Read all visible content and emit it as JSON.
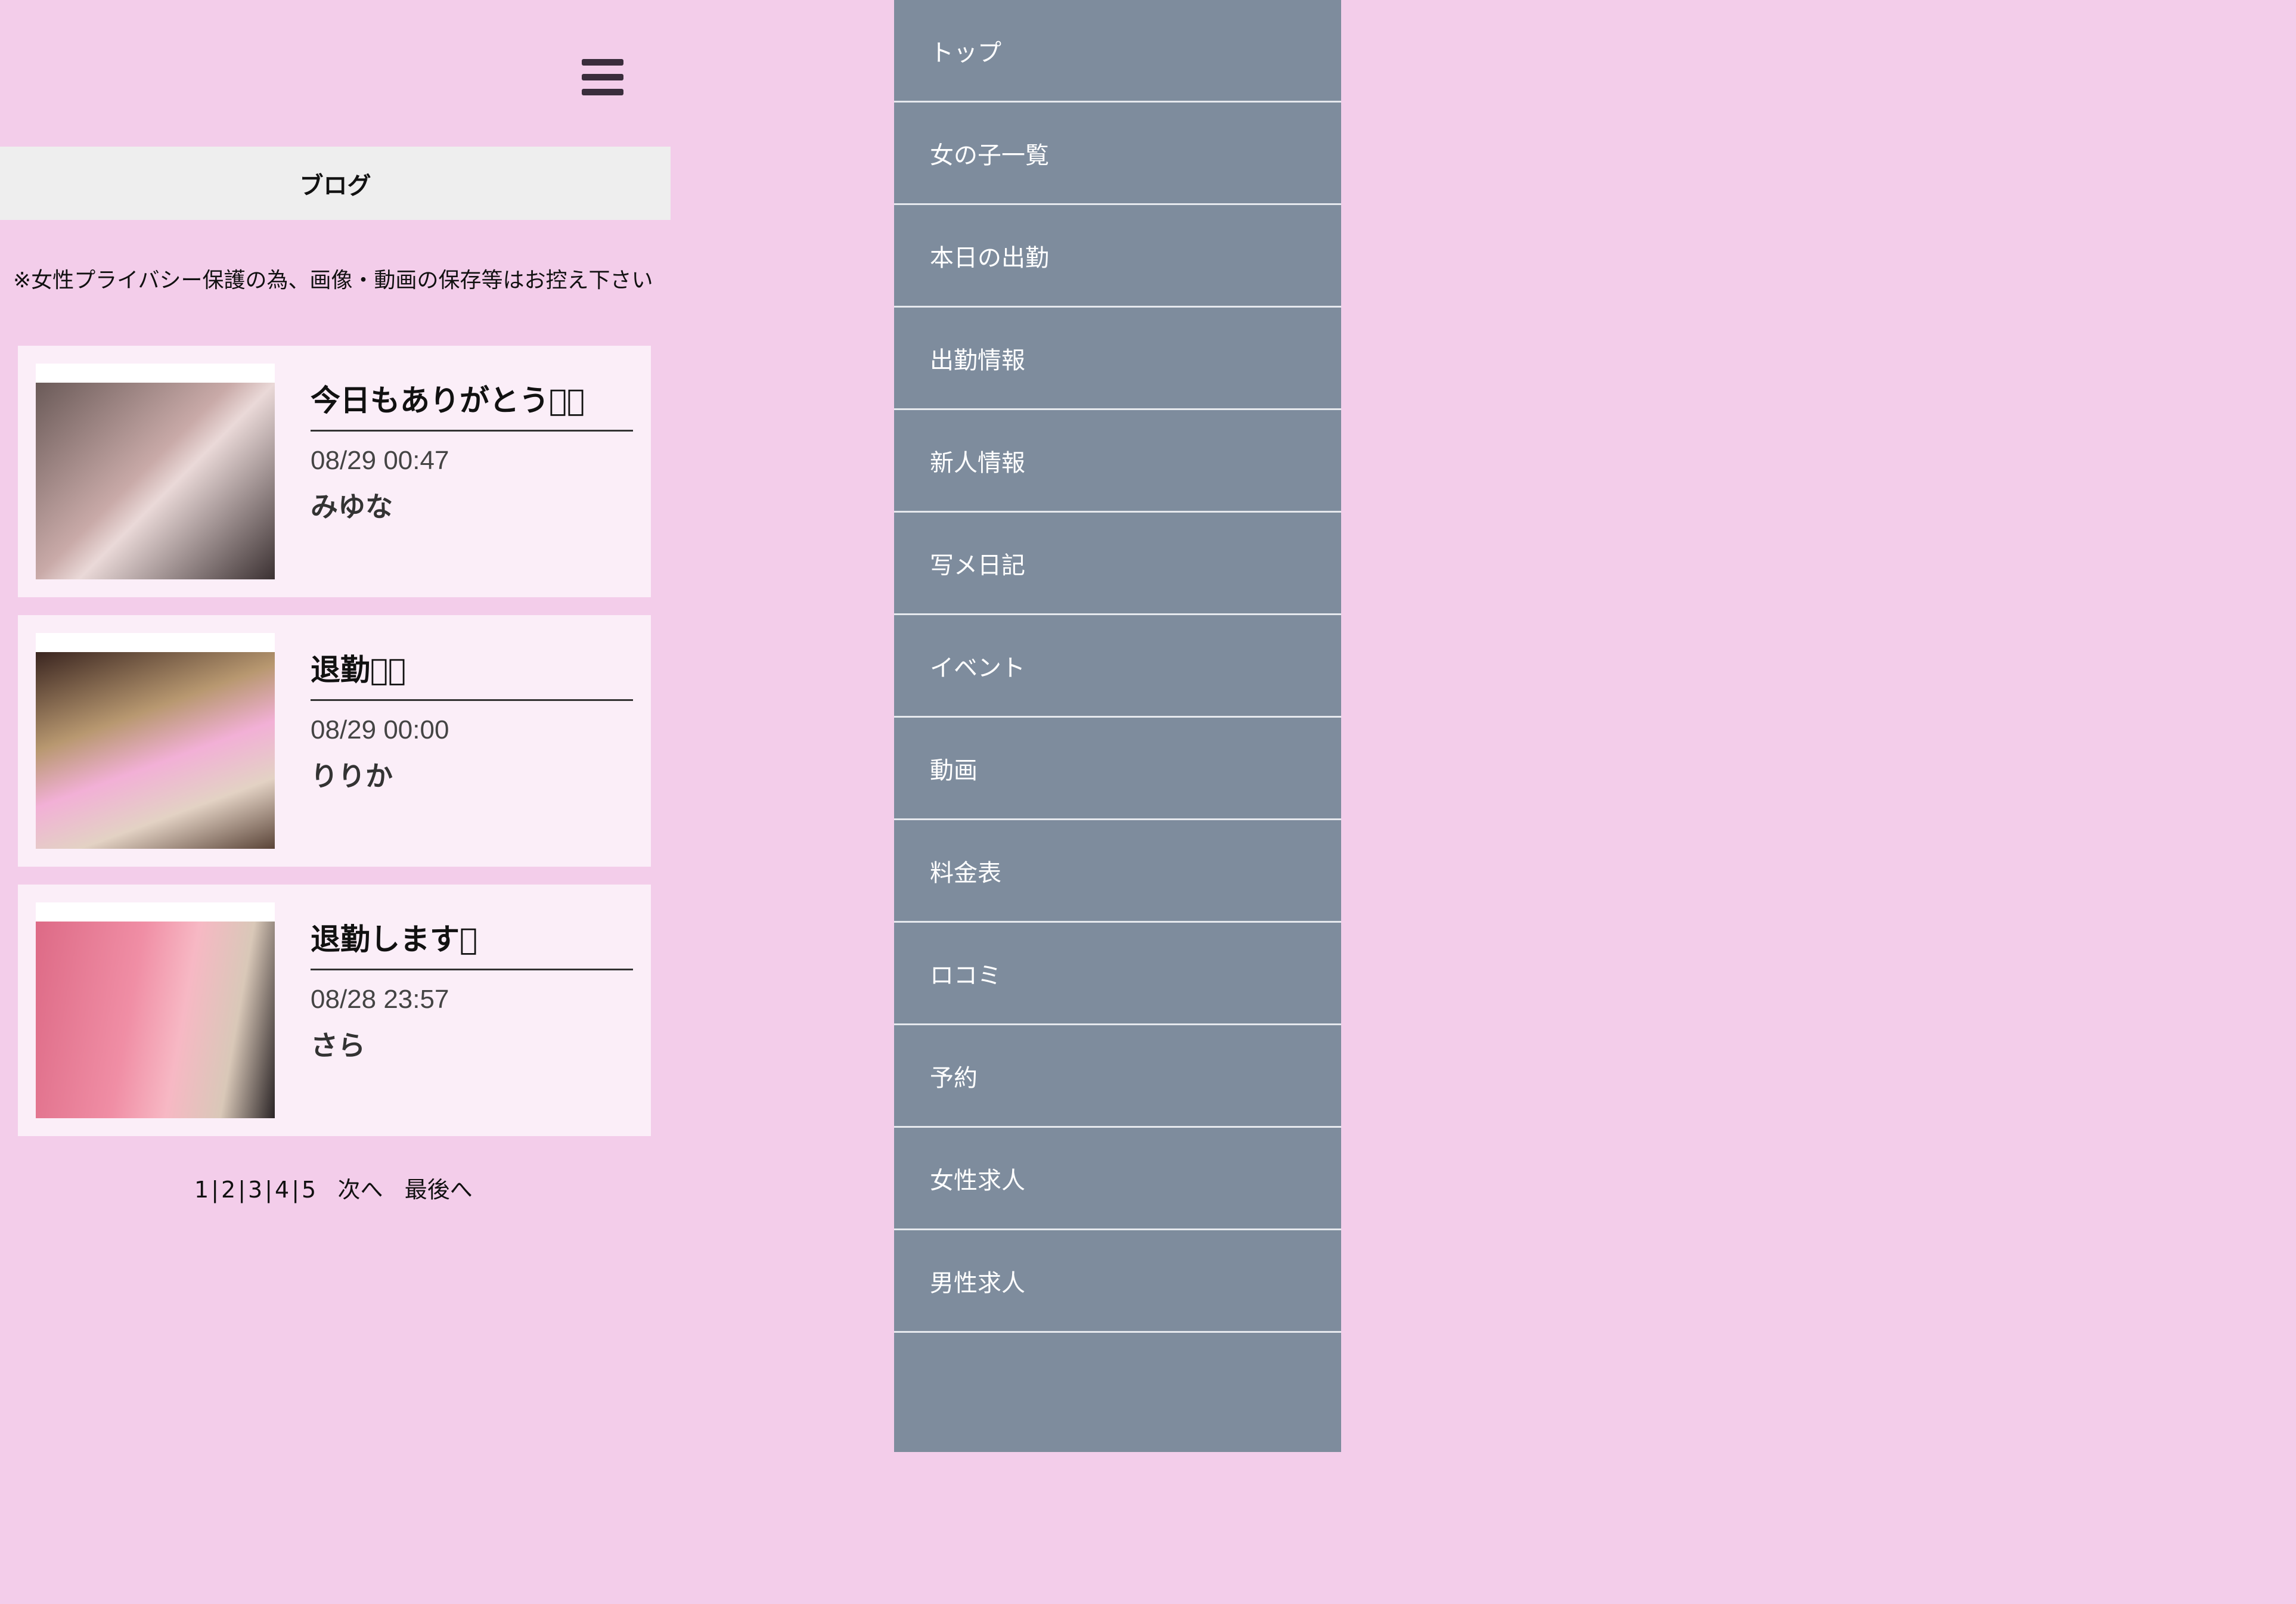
{
  "header": {
    "menu_icon": "hamburger-menu-icon"
  },
  "page": {
    "title": "ブログ",
    "notice": "※女性プライバシー保護の為、画像・動画の保存等はお控え下さい"
  },
  "posts": [
    {
      "title": "今日もありがとう􀎃􀎃",
      "date": "08/29 00:47",
      "author": "みゆな"
    },
    {
      "title": "退勤􀎃􀎃",
      "date": "08/29 00:00",
      "author": "りりか"
    },
    {
      "title": "退勤します􀎃",
      "date": "08/28 23:57",
      "author": "さら"
    }
  ],
  "pagination": {
    "pages": [
      "1",
      "2",
      "3",
      "4",
      "5"
    ],
    "separator": "|",
    "next": "次へ",
    "last": "最後へ"
  },
  "menu": {
    "items": [
      "トップ",
      "女の子一覧",
      "本日の出勤",
      "出勤情報",
      "新人情報",
      "写メ日記",
      "イベント",
      "動画",
      "料金表",
      "ロコミ",
      "予約",
      "女性求人",
      "男性求人"
    ]
  },
  "colors": {
    "background": "#f3cdea",
    "card": "#fbeef8",
    "menu": "#7e8c9d",
    "title_bar": "#eeeeee"
  }
}
